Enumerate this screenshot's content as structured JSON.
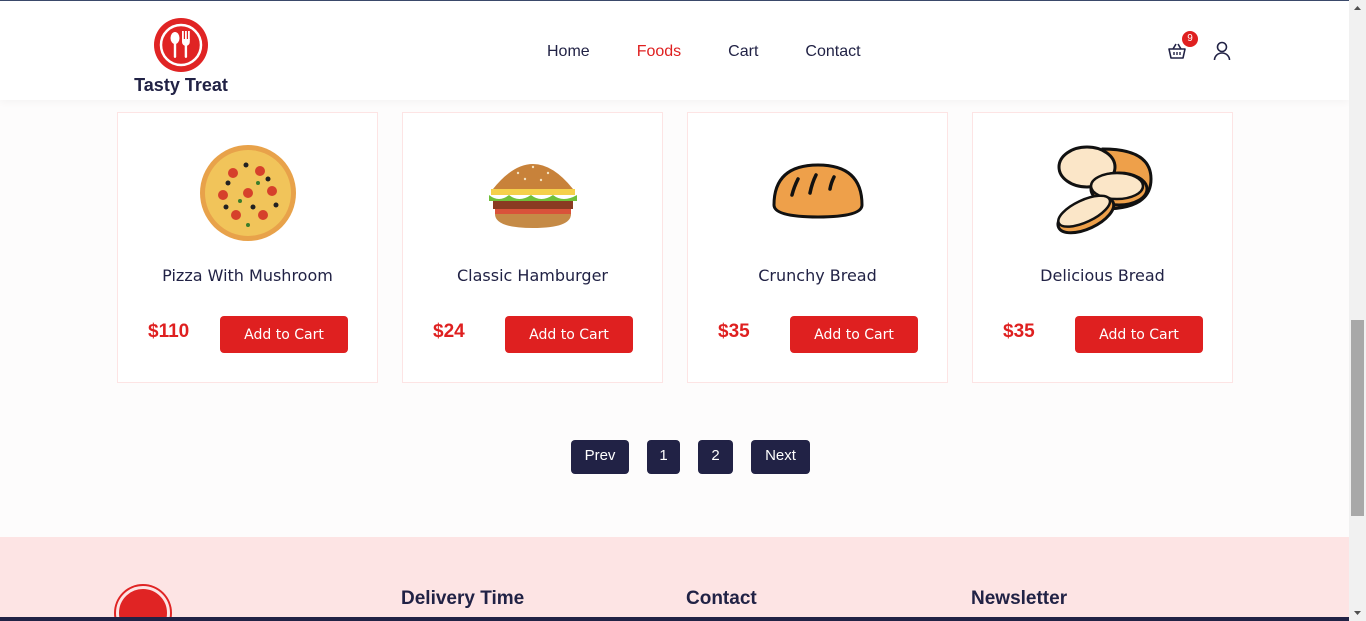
{
  "brand": {
    "name": "Tasty Treat",
    "accent": "#df2020",
    "dark": "#212245"
  },
  "nav": [
    {
      "label": "Home"
    },
    {
      "label": "Foods"
    },
    {
      "label": "Cart"
    },
    {
      "label": "Contact"
    }
  ],
  "cart": {
    "count": "9"
  },
  "products": [
    {
      "title": "Pizza With Mushroom",
      "price": "$110",
      "button": "Add to Cart",
      "icon": "pizza-image"
    },
    {
      "title": "Classic Hamburger",
      "price": "$24",
      "button": "Add to Cart",
      "icon": "hamburger-image"
    },
    {
      "title": "Crunchy Bread",
      "price": "$35",
      "button": "Add to Cart",
      "icon": "bread-image"
    },
    {
      "title": "Delicious Bread",
      "price": "$35",
      "button": "Add to Cart",
      "icon": "sliced-bread-image"
    }
  ],
  "pagination": {
    "prev": "Prev",
    "page1": "1",
    "page2": "2",
    "next": "Next"
  },
  "footer": {
    "delivery_title": "Delivery Time",
    "contact_title": "Contact",
    "newsletter_title": "Newsletter"
  }
}
